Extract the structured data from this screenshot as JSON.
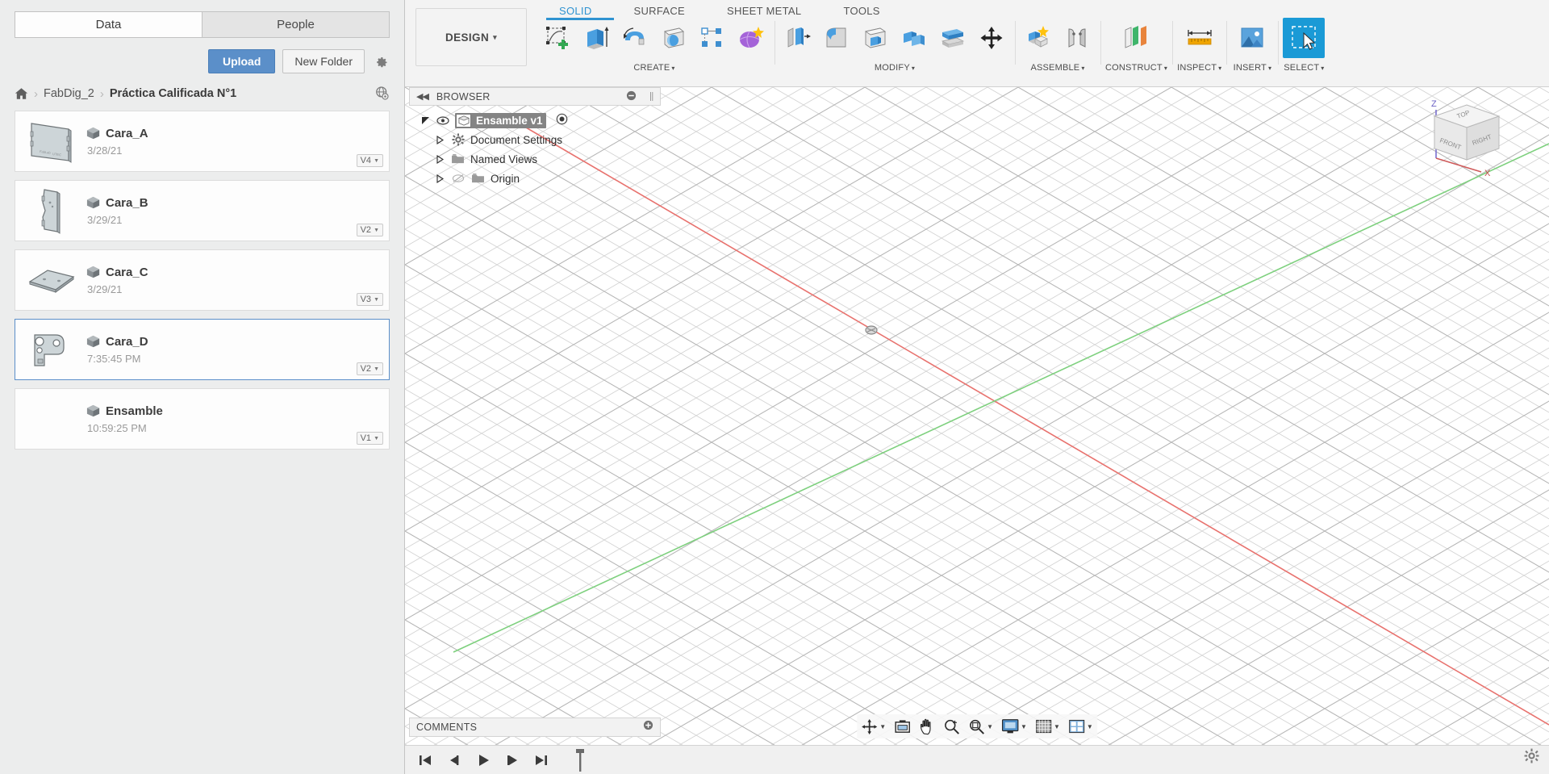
{
  "data_panel": {
    "tabs": [
      {
        "label": "Data",
        "active": true
      },
      {
        "label": "People",
        "active": false
      }
    ],
    "actions": {
      "upload_label": "Upload",
      "new_folder_label": "New Folder",
      "settings_icon": "gear-icon"
    },
    "breadcrumb": {
      "home_icon": "home-icon",
      "separator": "›",
      "items": [
        "FabDig_2",
        "Práctica Calificada N°1"
      ],
      "globe_icon": "globe-visibility-icon"
    },
    "files": [
      {
        "name": "Cara_A",
        "date": "3/28/21",
        "version": "V4",
        "selected": false,
        "icon": "component-cube-icon"
      },
      {
        "name": "Cara_B",
        "date": "3/29/21",
        "version": "V2",
        "selected": false,
        "icon": "component-cube-icon"
      },
      {
        "name": "Cara_C",
        "date": "3/29/21",
        "version": "V3",
        "selected": false,
        "icon": "component-cube-icon"
      },
      {
        "name": "Cara_D",
        "date": "7:35:45 PM",
        "version": "V2",
        "selected": true,
        "icon": "component-cube-icon"
      },
      {
        "name": "Ensamble",
        "date": "10:59:25 PM",
        "version": "V1",
        "selected": false,
        "icon": "component-cube-icon"
      }
    ]
  },
  "ribbon": {
    "workspace": {
      "label": "DESIGN",
      "caret": "▾"
    },
    "tabs": [
      {
        "label": "SOLID",
        "active": true
      },
      {
        "label": "SURFACE",
        "active": false
      },
      {
        "label": "SHEET METAL",
        "active": false
      },
      {
        "label": "TOOLS",
        "active": false
      }
    ],
    "groups": [
      {
        "label": "CREATE",
        "caret": "▾",
        "tools": [
          "create-sketch-icon",
          "extrude-icon",
          "revolve-icon",
          "sphere-icon",
          "pattern-icon",
          "form-icon"
        ]
      },
      {
        "label": "MODIFY",
        "caret": "▾",
        "tools": [
          "press-pull-icon",
          "fillet-icon",
          "shell-icon",
          "combine-icon",
          "split-face-icon",
          "move-copy-icon"
        ]
      },
      {
        "label": "ASSEMBLE",
        "caret": "▾",
        "tools": [
          "new-component-icon",
          "joint-icon"
        ]
      },
      {
        "label": "CONSTRUCT",
        "caret": "▾",
        "tools": [
          "offset-plane-icon"
        ]
      },
      {
        "label": "INSPECT",
        "caret": "▾",
        "tools": [
          "measure-icon"
        ]
      },
      {
        "label": "INSERT",
        "caret": "▾",
        "tools": [
          "insert-image-icon"
        ]
      },
      {
        "label": "SELECT",
        "caret": "▾",
        "tools": [
          "select-arrow-icon"
        ],
        "active": true
      }
    ]
  },
  "browser": {
    "title": "BROWSER",
    "collapse_icon": "collapse-left-icon",
    "options_icon": "minus-circle-icon",
    "tree": [
      {
        "label": "Ensamble v1",
        "selected": true,
        "icon": "document-cube-icon",
        "eye": true,
        "expanded": true,
        "depth": 0
      },
      {
        "label": "Document Settings",
        "selected": false,
        "icon": "gear-icon",
        "eye": false,
        "expanded": false,
        "depth": 1
      },
      {
        "label": "Named Views",
        "selected": false,
        "icon": "folder-icon",
        "eye": false,
        "expanded": false,
        "depth": 1
      },
      {
        "label": "Origin",
        "selected": false,
        "icon": "folder-icon",
        "eye": false,
        "hidden_eye": true,
        "expanded": false,
        "depth": 1
      }
    ]
  },
  "comments": {
    "title": "COMMENTS",
    "add_icon": "plus-circle-icon"
  },
  "viewcube": {
    "faces": [
      "TOP",
      "FRONT",
      "RIGHT"
    ],
    "axes": [
      "Z",
      "X"
    ]
  },
  "view_controls": [
    {
      "name": "orbit-icon",
      "has_caret": true
    },
    {
      "name": "look-at-icon",
      "has_caret": false
    },
    {
      "name": "pan-icon",
      "has_caret": false
    },
    {
      "name": "zoom-icon",
      "has_caret": false
    },
    {
      "name": "fit-icon",
      "has_caret": true
    },
    {
      "name": "display-settings-icon",
      "has_caret": true
    },
    {
      "name": "grid-snaps-icon",
      "has_caret": true
    },
    {
      "name": "viewports-icon",
      "has_caret": true
    }
  ],
  "timeline": {
    "buttons": [
      "go-to-beginning-icon",
      "step-back-icon",
      "play-icon",
      "step-forward-icon",
      "go-to-end-icon"
    ],
    "marker": "timeline-marker-icon",
    "settings_icon": "gear-icon"
  },
  "colors": {
    "accent_blue": "#2f93d1",
    "upload_blue": "#5b8fc9",
    "select_active": "#1a9ad6",
    "axis_x_red": "#e8726e",
    "axis_y_green": "#7ed07e",
    "panel_bg": "#eceded",
    "tree_selected": "#848484"
  }
}
